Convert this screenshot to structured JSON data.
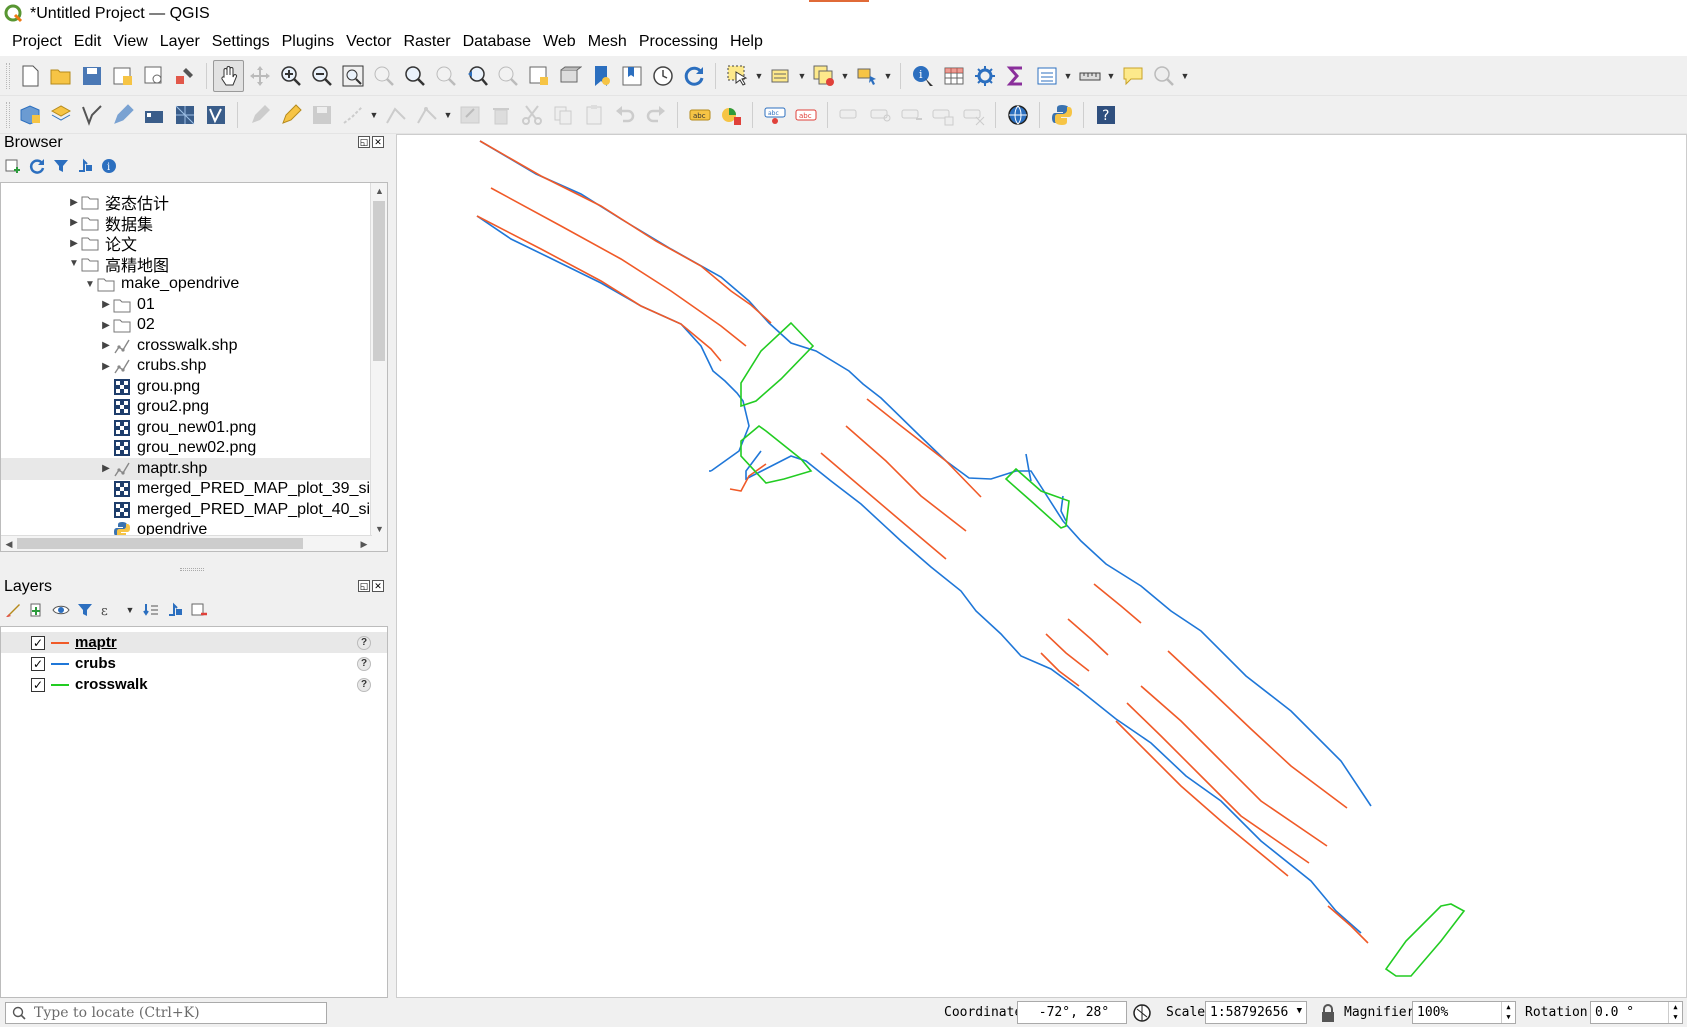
{
  "window": {
    "title": "*Untitled Project — QGIS"
  },
  "menu": [
    "Project",
    "Edit",
    "View",
    "Layer",
    "Settings",
    "Plugins",
    "Vector",
    "Raster",
    "Database",
    "Web",
    "Mesh",
    "Processing",
    "Help"
  ],
  "browser": {
    "title": "Browser",
    "items": [
      {
        "label": "姿态估计",
        "type": "folder",
        "expanded": false
      },
      {
        "label": "数据集",
        "type": "folder",
        "expanded": false
      },
      {
        "label": "论文",
        "type": "folder",
        "expanded": false
      },
      {
        "label": "高精地图",
        "type": "folder",
        "expanded": true
      },
      {
        "label": "make_opendrive",
        "type": "folder",
        "expanded": true
      },
      {
        "label": "01",
        "type": "folder",
        "expanded": false
      },
      {
        "label": "02",
        "type": "folder",
        "expanded": false
      },
      {
        "label": "crosswalk.shp",
        "type": "vector",
        "expanded": false
      },
      {
        "label": "crubs.shp",
        "type": "vector",
        "expanded": false
      },
      {
        "label": "grou.png",
        "type": "raster"
      },
      {
        "label": "grou2.png",
        "type": "raster"
      },
      {
        "label": "grou_new01.png",
        "type": "raster"
      },
      {
        "label": "grou_new02.png",
        "type": "raster"
      },
      {
        "label": "maptr.shp",
        "type": "vector",
        "expanded": false,
        "selected": true
      },
      {
        "label": "merged_PRED_MAP_plot_39_si",
        "type": "raster"
      },
      {
        "label": "merged_PRED_MAP_plot_40_si",
        "type": "raster"
      },
      {
        "label": "opendrive",
        "type": "python"
      }
    ]
  },
  "layers": {
    "title": "Layers",
    "items": [
      {
        "name": "maptr",
        "color": "#f05a28",
        "checked": true,
        "active": true
      },
      {
        "name": "crubs",
        "color": "#1f77d8",
        "checked": true,
        "active": false
      },
      {
        "name": "crosswalk",
        "color": "#22cc22",
        "checked": true,
        "active": false
      }
    ]
  },
  "status": {
    "locate_placeholder": "Type to locate (Ctrl+K)",
    "coordinate_label": "Coordinate",
    "coordinate_value": "-72°, 28°",
    "scale_label": "Scale",
    "scale_value": "1:58792656",
    "magnifier_label": "Magnifier",
    "magnifier_value": "100%",
    "rotation_label": "Rotation",
    "rotation_value": "0.0 °"
  },
  "colors": {
    "maptr": "#f05a28",
    "crubs": "#1f77d8",
    "crosswalk": "#22cc22"
  }
}
